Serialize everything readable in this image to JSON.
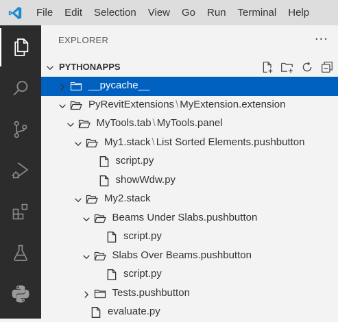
{
  "menubar": {
    "items": [
      "File",
      "Edit",
      "Selection",
      "View",
      "Go",
      "Run",
      "Terminal",
      "Help"
    ]
  },
  "activitybar": {
    "icons": [
      "explorer-icon",
      "search-icon",
      "source-control-icon",
      "run-debug-icon",
      "extensions-icon",
      "testing-icon",
      "python-icon"
    ]
  },
  "sidebar": {
    "header": "EXPLORER",
    "more": "···",
    "section_title": "PYTHONAPPS",
    "tree": [
      {
        "parts": [
          "__pycache__"
        ],
        "type": "folder",
        "expanded": false,
        "depth": 0,
        "selected": true
      },
      {
        "parts": [
          "PyRevitExtensions",
          "MyExtension.extension"
        ],
        "type": "folder",
        "expanded": true,
        "depth": 0
      },
      {
        "parts": [
          "MyTools.tab",
          "MyTools.panel"
        ],
        "type": "folder",
        "expanded": true,
        "depth": 1
      },
      {
        "parts": [
          "My1.stack",
          "List Sorted Elements.pushbutton"
        ],
        "type": "folder",
        "expanded": true,
        "depth": 2
      },
      {
        "parts": [
          "script.py"
        ],
        "type": "file",
        "depth": 3
      },
      {
        "parts": [
          "showWdw.py"
        ],
        "type": "file",
        "depth": 3
      },
      {
        "parts": [
          "My2.stack"
        ],
        "type": "folder",
        "expanded": true,
        "depth": 2
      },
      {
        "parts": [
          "Beams Under Slabs.pushbutton"
        ],
        "type": "folder",
        "expanded": true,
        "depth": 3
      },
      {
        "parts": [
          "script.py"
        ],
        "type": "file",
        "depth": 4
      },
      {
        "parts": [
          "Slabs Over Beams.pushbutton"
        ],
        "type": "folder",
        "expanded": true,
        "depth": 3
      },
      {
        "parts": [
          "script.py"
        ],
        "type": "file",
        "depth": 4
      },
      {
        "parts": [
          "Tests.pushbutton"
        ],
        "type": "folder",
        "expanded": false,
        "depth": 3
      },
      {
        "parts": [
          "evaluate.py"
        ],
        "type": "file",
        "depth": 2
      }
    ]
  },
  "colors": {
    "selection": "#0060c0",
    "activitybar": "#2c2c2c",
    "menubar": "#dddddd",
    "sidebar": "#f3f3f3"
  }
}
